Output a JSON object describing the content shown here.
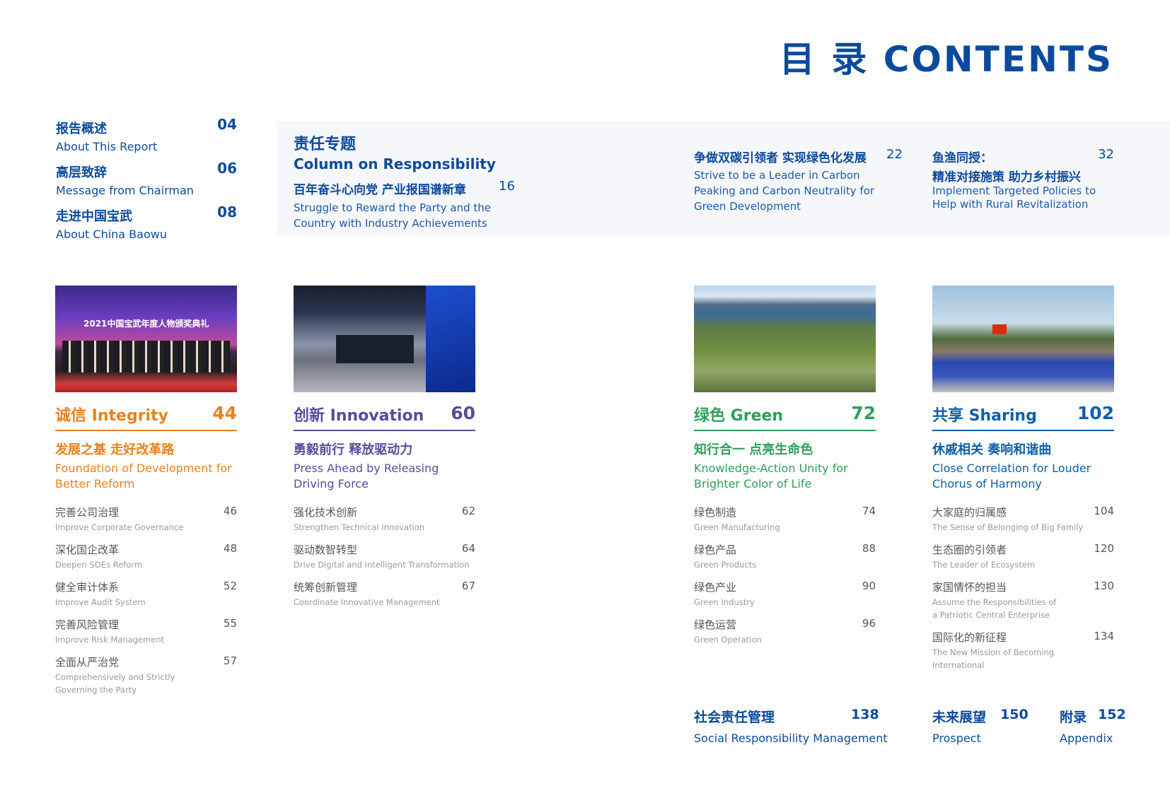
{
  "title": "目 录 CONTENTS",
  "intro": [
    {
      "cn": "报告概述",
      "en": "About This Report",
      "page": "04"
    },
    {
      "cn": "高层致辞",
      "en": "Message from Chairman",
      "page": "06"
    },
    {
      "cn": "走进中国宝武",
      "en": "About China Baowu",
      "page": "08"
    }
  ],
  "column": {
    "cn": "责任专题",
    "en": "Column on Responsibility",
    "items": [
      {
        "cn": "百年奋斗心向党  产业报国谱新章",
        "en1": "Struggle to Reward the Party and the",
        "en2": "Country with Industry Achievements",
        "page": "16"
      },
      {
        "cn": "争做双碳引领者  实现绿色化发展",
        "en1": "Strive to be a Leader in Carbon",
        "en2": "Peaking and Carbon Neutrality for",
        "en3": "Green Development",
        "page": "22"
      },
      {
        "cn": "鱼渔同授：",
        "cn2": "精准对接施策  助力乡村振兴",
        "en1": "Implement Targeted Policies to",
        "en2": "Help with Rural Revitalization",
        "page": "32"
      }
    ]
  },
  "colors": {
    "integrity": "#e8821e",
    "innovation": "#5a4a9c",
    "green": "#2f9e5e",
    "sharing": "#0e5fa8",
    "title": "#0b4a9c"
  },
  "sections": [
    {
      "head": "诚信 Integrity",
      "page": "44",
      "sub_cn": "发展之基 走好改革路",
      "sub_en1": "Foundation of Development for",
      "sub_en2": "Better Reform",
      "photo_caption": "2021中国宝武年度人物颁奖典礼",
      "items": [
        {
          "cn": "完善公司治理",
          "en": "Improve Corporate Governance",
          "page": "46"
        },
        {
          "cn": "深化国企改革",
          "en": "Deepen SOEs Reform",
          "page": "48"
        },
        {
          "cn": "健全审计体系",
          "en": "Improve Audit System",
          "page": "52"
        },
        {
          "cn": "完善风险管理",
          "en": "Improve Risk Management",
          "page": "55"
        },
        {
          "cn": "全面从严治党",
          "en": "Comprehensively and Strictly",
          "en2": "Governing the Party",
          "page": "57"
        }
      ]
    },
    {
      "head": "创新 Innovation",
      "page": "60",
      "sub_cn": "勇毅前行 释放驱动力",
      "sub_en1": "Press Ahead by Releasing",
      "sub_en2": "Driving Force",
      "items": [
        {
          "cn": "强化技术创新",
          "en": "Strengthen Technical Innovation",
          "page": "62"
        },
        {
          "cn": "驱动数智转型",
          "en": "Drive Digital and Intelligent Transformation",
          "page": "64"
        },
        {
          "cn": "统筹创新管理",
          "en": "Coordinate Innovative Management",
          "page": "67"
        }
      ]
    },
    {
      "head": "绿色 Green",
      "page": "72",
      "sub_cn": "知行合一 点亮生命色",
      "sub_en1": "Knowledge-Action Unity for",
      "sub_en2": "Brighter Color of Life",
      "items": [
        {
          "cn": "绿色制造",
          "en": "Green Manufacturing",
          "page": "74"
        },
        {
          "cn": "绿色产品",
          "en": "Green Products",
          "page": "88"
        },
        {
          "cn": "绿色产业",
          "en": "Green Industry",
          "page": "90"
        },
        {
          "cn": "绿色运营",
          "en": "Green Operation",
          "page": "96"
        }
      ]
    },
    {
      "head": "共享 Sharing",
      "page": "102",
      "sub_cn": "休戚相关 奏响和谐曲",
      "sub_en1": "Close Correlation for Louder",
      "sub_en2": "Chorus of Harmony",
      "items": [
        {
          "cn": "大家庭的归属感",
          "en": "The Sense of Belonging of Big Family",
          "page": "104"
        },
        {
          "cn": "生态圈的引领者",
          "en": "The Leader of Ecosystem",
          "page": "120"
        },
        {
          "cn": "家国情怀的担当",
          "en": "Assume the Responsibilities of",
          "en2": "a Patriotic Central Enterprise",
          "page": "130"
        },
        {
          "cn": "国际化的新征程",
          "en": "The New Mission of Becoming",
          "en2": "International",
          "page": "134"
        }
      ]
    }
  ],
  "bottom": [
    {
      "cn": "社会责任管理",
      "en": "Social Responsibility Management",
      "page": "138"
    },
    {
      "cn": "未来展望",
      "en": "Prospect",
      "page": "150"
    },
    {
      "cn": "附录",
      "en": "Appendix",
      "page": "152"
    }
  ]
}
